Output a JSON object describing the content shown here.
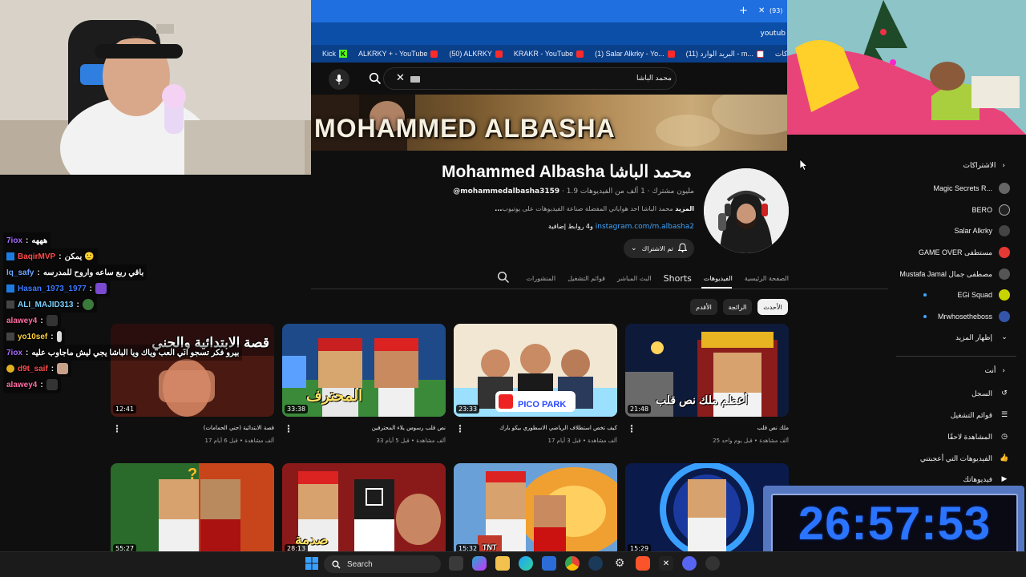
{
  "browser": {
    "tab_count_label": "(93)",
    "tab_close": "✕",
    "new_tab": "+",
    "url_fragment": "youtub",
    "bookmarks": [
      {
        "label": "Kick"
      },
      {
        "label": "ALKRKY + - YouTube"
      },
      {
        "label": "(50) ALKRKY"
      },
      {
        "label": "KRAKR - YouTube"
      },
      {
        "label": "(1) Salar Alkrky - Yo..."
      },
      {
        "label": "(11) البريد الوارد - m..."
      },
      {
        "label": "الاشتراكات"
      }
    ]
  },
  "header": {
    "search_query": "محمد الباشا"
  },
  "channel": {
    "banner_text": "MOHAMMED ALBASHA",
    "name": "Mohammed Albasha محمد الباشا",
    "handle": "@mohammedalbasha3159",
    "meta_rest": " ‧ 1.9 مليون مشترك ‧ 1 ألف من الفيديوهات",
    "description": "محمد الباشا احد هواياتي المفضلة صناعة الفيديوهات على يوتيوب",
    "more": "...المزيد",
    "link": "instagram.com/m.albasha2",
    "link_extra": " و4 روابط إضافية",
    "subscribed_label": "تم الاشتراك"
  },
  "tabs": [
    {
      "label": "الصفحة الرئيسية",
      "active": false
    },
    {
      "label": "الفيديوهات",
      "active": true
    },
    {
      "label": "Shorts",
      "active": false,
      "bold": true
    },
    {
      "label": "البث المباشر",
      "active": false
    },
    {
      "label": "قوائم التشغيل",
      "active": false
    },
    {
      "label": "المنشورات",
      "active": false
    }
  ],
  "chips": [
    {
      "label": "الأحدث",
      "active": true
    },
    {
      "label": "الرائجة",
      "active": false
    },
    {
      "label": "الأقدم",
      "active": false
    }
  ],
  "videos": [
    {
      "title": "قصة الابتدائية (جني الحمامات)",
      "stats": "17 ألف مشاهدة • قبل 6 أيام",
      "duration": "12:41",
      "thumb_text": "قصة الابتدائية والجني",
      "colors": [
        "#3b1414",
        "#7a2b1f"
      ]
    },
    {
      "title": "نص قلب رسوس يلاء المحترفين",
      "stats": "33 ألف مشاهدة • قبل 5 أيام",
      "duration": "33:38",
      "thumb_text": "المحترف",
      "colors": [
        "#1f4a8a",
        "#3a8a3a"
      ]
    },
    {
      "title": "كيف تخص استطلاف الرياضي الاسطوري بيكو بارك",
      "stats": "17 ألف مشاهدة • قبل 3 أيام",
      "duration": "23:33",
      "thumb_text": "PICO PARK",
      "colors": [
        "#f1e7d2",
        "#4aa3ff"
      ]
    },
    {
      "title": "ملك نص قلب",
      "stats": "25 ألف مشاهدة • قبل يوم واحد",
      "duration": "21:48",
      "thumb_text": "أعظم ملك نص قلب",
      "colors": [
        "#0e1a3a",
        "#8a1c1c"
      ]
    },
    {
      "title": "",
      "stats": "",
      "duration": "55:27",
      "thumb_text": "",
      "colors": [
        "#2a6a2a",
        "#c8451c"
      ]
    },
    {
      "title": "",
      "stats": "",
      "duration": "28:13",
      "thumb_text": "صدمة",
      "colors": [
        "#8a1a1a",
        "#2a2a2a"
      ]
    },
    {
      "title": "",
      "stats": "",
      "duration": "15:32",
      "thumb_text": "TNT",
      "colors": [
        "#c86a1a",
        "#f0c040"
      ]
    },
    {
      "title": "",
      "stats": "",
      "duration": "15:29",
      "thumb_text": "",
      "colors": [
        "#0a1a4a",
        "#2a7aff"
      ]
    }
  ],
  "sidebar": {
    "subscriptions_heading": "الاشتراكات",
    "subscriptions": [
      {
        "label": "Magic Secrets R...",
        "color": "#666666"
      },
      {
        "label": "BERO",
        "color": "#222222"
      },
      {
        "label": "Salar Alkrky",
        "color": "#444444"
      },
      {
        "label": "GAME OVER مستطفى",
        "color": "#e53935"
      },
      {
        "label": "Mustafa Jamal مصطفى جمال",
        "color": "#555555"
      },
      {
        "label": "EGi Squad",
        "color": "#c8d400"
      },
      {
        "label": "Mrwhosetheboss",
        "color": "#3355aa"
      }
    ],
    "show_more": "إظهار المزيد",
    "you_heading": "أنت",
    "you_items": [
      {
        "label": "السجل",
        "icon": "↺"
      },
      {
        "label": "قوائم التشغيل",
        "icon": "☰"
      },
      {
        "label": "المشاهدة لاحقًا",
        "icon": "◷"
      },
      {
        "label": "الفيديوهات التي أعجبتني",
        "icon": "👍"
      },
      {
        "label": "فيديوهاتك",
        "icon": "▶"
      }
    ]
  },
  "chat": [
    {
      "user": "7iox",
      "color": "#a970ff",
      "msg": "هههه"
    },
    {
      "user": "BaqirMVP",
      "color": "#ff4d4d",
      "msg": "يمكن 🙂"
    },
    {
      "user": "Iq_safy",
      "color": "#6fa8ff",
      "msg": "باقي ربع ساعه واروح للمدرسه"
    },
    {
      "user": "Hasan_1973_1977",
      "color": "#3d7bff",
      "msg": ""
    },
    {
      "user": "ALI_MAJID313",
      "color": "#7ad0ff",
      "msg": ""
    },
    {
      "user": "alawey4",
      "color": "#ff6fa3",
      "msg": ""
    },
    {
      "user": "yo10sef",
      "color": "#ffd23d",
      "msg": ""
    },
    {
      "user": "7iox",
      "color": "#a970ff",
      "msg": "بيرو فكر تسجو اني العب وياك ويا الباشا يجي ليش ماجاوب عليه"
    },
    {
      "user": "d9t_saif",
      "color": "#ff4d4d",
      "msg": ""
    },
    {
      "user": "alawey4",
      "color": "#ff6fa3",
      "msg": ""
    }
  ],
  "timer": "26:57:53",
  "taskbar": {
    "search_label": "Search"
  }
}
